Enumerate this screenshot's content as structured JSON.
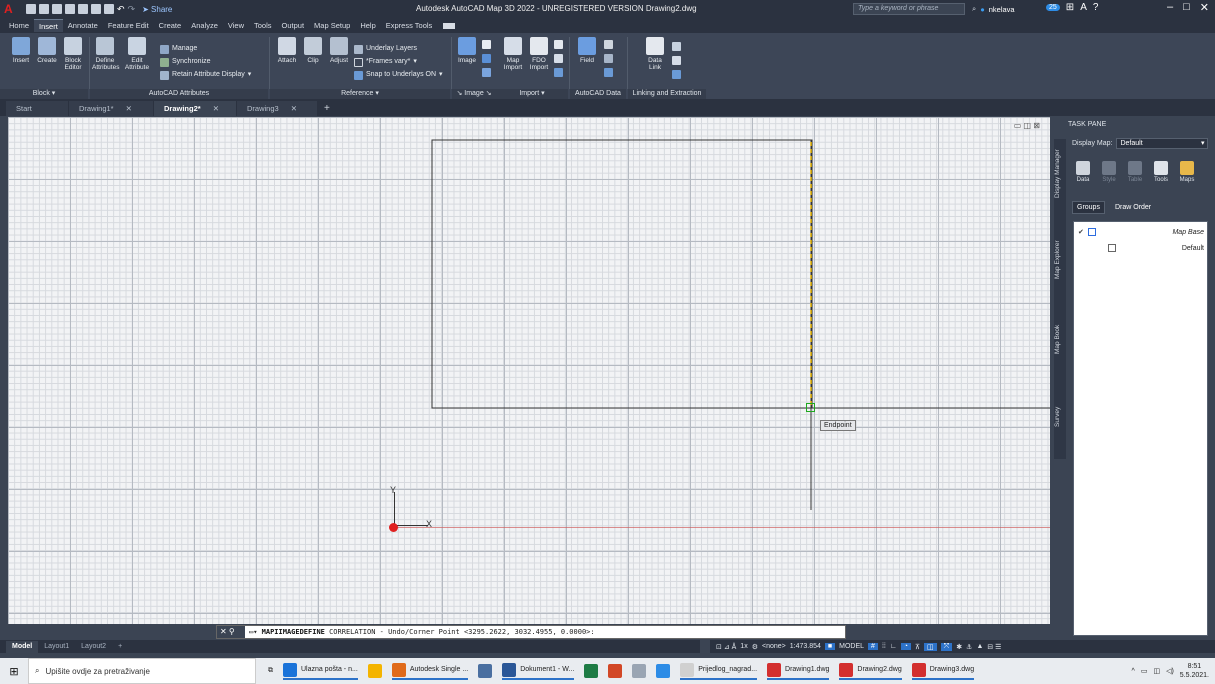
{
  "titlebar": {
    "logo": "A",
    "share_label": "Share",
    "title": "Autodesk AutoCAD Map 3D 2022 - UNREGISTERED VERSION   Drawing2.dwg",
    "search_placeholder": "Type a keyword or phrase",
    "username": "nkelava",
    "notif_count": "25"
  },
  "ribbon_tabs": [
    "Home",
    "Insert",
    "Annotate",
    "Feature Edit",
    "Create",
    "Analyze",
    "View",
    "Tools",
    "Output",
    "Map Setup",
    "Help",
    "Express Tools"
  ],
  "ribbon": {
    "block": {
      "title": "Block",
      "insert": "Insert",
      "create": "Create",
      "block_editor": "Block Editor"
    },
    "attributes": {
      "title": "AutoCAD Attributes",
      "define": "Define Attributes",
      "edit": "Edit Attribute",
      "manage": "Manage",
      "synchronize": "Synchronize",
      "retain": "Retain Attribute Display"
    },
    "reference": {
      "title": "Reference",
      "attach": "Attach",
      "clip": "Clip",
      "adjust": "Adjust",
      "underlay_layers": "Underlay Layers",
      "frames_vary": "*Frames vary*",
      "snap_underlays": "Snap to Underlays ON"
    },
    "image": {
      "title": "Image",
      "image": "Image"
    },
    "import": {
      "title": "Import",
      "map_import": "Map Import",
      "fdo_import": "FDO Import"
    },
    "autocad_data": {
      "title": "AutoCAD Data",
      "field": "Field"
    },
    "linking": {
      "title": "Linking and Extraction",
      "data_link": "Data Link"
    }
  },
  "doc_tabs": [
    {
      "label": "Start",
      "closable": false
    },
    {
      "label": "Drawing1*",
      "closable": true
    },
    {
      "label": "Drawing2*",
      "closable": true
    },
    {
      "label": "Drawing3",
      "closable": true
    }
  ],
  "canvas": {
    "ucs_y": "Y",
    "ucs_x": "X",
    "osnap_tooltip": "Endpoint"
  },
  "taskpane": {
    "header": "TASK PANE",
    "display_map_label": "Display Map:",
    "display_map_value": "Default",
    "side_tabs": [
      "Display Manager",
      "Map Explorer",
      "Map Book",
      "Survey"
    ],
    "tools": [
      "Data",
      "Style",
      "Table",
      "Tools",
      "Maps"
    ],
    "groups_label": "Groups",
    "draw_order_label": "Draw Order",
    "tree": [
      {
        "label": "Map Base",
        "checked": true
      },
      {
        "label": "Default",
        "checked": false
      }
    ]
  },
  "command_line": {
    "command": "MAPIIMAGEDEFINE",
    "text": "CORRELATION - Undo/Corner Point <3295.2622, 3032.4955, 0.0000>:"
  },
  "layout_tabs": [
    "Model",
    "Layout1",
    "Layout2"
  ],
  "statusbar": {
    "scale_ann": "1x",
    "coord_none": "<none>",
    "scale": "1:473.854",
    "mode": "MODEL"
  },
  "taskbar": {
    "search_placeholder": "Upišite ovdje za pretraživanje",
    "apps": [
      {
        "label": "Ulazna pošta - n...",
        "color": "#1a73d9"
      },
      {
        "label": "",
        "color": "#f4b400"
      },
      {
        "label": "Autodesk Single ...",
        "color": "#e06a1a"
      },
      {
        "label": "",
        "color": "#4a6fa0"
      },
      {
        "label": "Dokument1 - W...",
        "color": "#2b5797"
      },
      {
        "label": "",
        "color": "#1e7b45"
      },
      {
        "label": "",
        "color": "#d24726"
      },
      {
        "label": "",
        "color": "#9aa5b3"
      },
      {
        "label": "",
        "color": "#2d8ce6"
      },
      {
        "label": "Prijedlog_nagrad...",
        "color": "#d0d0d0"
      },
      {
        "label": "Drawing1.dwg",
        "color": "#d32f2f"
      },
      {
        "label": "Drawing2.dwg",
        "color": "#d32f2f"
      },
      {
        "label": "Drawing3.dwg",
        "color": "#d32f2f"
      }
    ],
    "time": "8:51",
    "date": "5.5.2021."
  },
  "colors": {
    "accent": "#2d72c8",
    "autocad_red": "#d32f2f",
    "osnap_green": "#1fa81f"
  }
}
